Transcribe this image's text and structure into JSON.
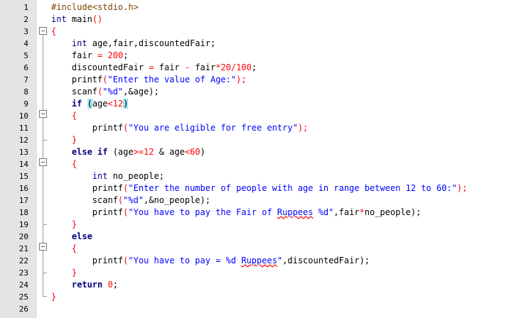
{
  "editor": {
    "lines": [
      {
        "n": "1",
        "segs": [
          {
            "t": "#include<stdio.h>",
            "c": "pp"
          }
        ]
      },
      {
        "n": "2",
        "segs": [
          {
            "t": "int",
            "c": "ty"
          },
          {
            "t": " main",
            "c": "id"
          },
          {
            "t": "()",
            "c": "op"
          }
        ]
      },
      {
        "n": "3",
        "segs": [
          {
            "t": "{",
            "c": "op"
          }
        ]
      },
      {
        "n": "4",
        "segs": [
          {
            "t": "    int",
            "c": "ty"
          },
          {
            "t": " age,fair,discountedFair;",
            "c": "id"
          }
        ]
      },
      {
        "n": "5",
        "segs": [
          {
            "t": "    fair ",
            "c": "id"
          },
          {
            "t": "=",
            "c": "op"
          },
          {
            "t": " ",
            "c": "id"
          },
          {
            "t": "200",
            "c": "nm"
          },
          {
            "t": ";",
            "c": "id"
          }
        ]
      },
      {
        "n": "6",
        "segs": [
          {
            "t": "    discountedFair ",
            "c": "id"
          },
          {
            "t": "=",
            "c": "op"
          },
          {
            "t": " fair ",
            "c": "id"
          },
          {
            "t": "-",
            "c": "op"
          },
          {
            "t": " fair",
            "c": "id"
          },
          {
            "t": "*20/100",
            "c": "nm"
          },
          {
            "t": ";",
            "c": "id"
          }
        ]
      },
      {
        "n": "7",
        "segs": [
          {
            "t": "    printf",
            "c": "id"
          },
          {
            "t": "(",
            "c": "op"
          },
          {
            "t": "\"Enter the value of Age:\"",
            "c": "st"
          },
          {
            "t": ");",
            "c": "op"
          }
        ]
      },
      {
        "n": "8",
        "segs": [
          {
            "t": "    scanf",
            "c": "id"
          },
          {
            "t": "(",
            "c": "op"
          },
          {
            "t": "\"%d\"",
            "c": "st"
          },
          {
            "t": ",&age);",
            "c": "id"
          }
        ]
      },
      {
        "n": "9",
        "segs": [
          {
            "t": "    if ",
            "c": "kw"
          },
          {
            "t": "(",
            "c": "hl"
          },
          {
            "t": "age",
            "c": "id"
          },
          {
            "t": "<12",
            "c": "nm"
          },
          {
            "t": ")",
            "c": "hl"
          }
        ]
      },
      {
        "n": "10",
        "segs": [
          {
            "t": "    {",
            "c": "op"
          }
        ]
      },
      {
        "n": "11",
        "segs": [
          {
            "t": "        printf",
            "c": "id"
          },
          {
            "t": "(",
            "c": "op"
          },
          {
            "t": "\"You are eligible for free entry\"",
            "c": "st"
          },
          {
            "t": ");",
            "c": "op"
          }
        ]
      },
      {
        "n": "12",
        "segs": [
          {
            "t": "    }",
            "c": "op"
          }
        ]
      },
      {
        "n": "13",
        "segs": [
          {
            "t": "    else if ",
            "c": "kw"
          },
          {
            "t": "(age",
            "c": "id"
          },
          {
            "t": ">=12",
            "c": "nm"
          },
          {
            "t": " & age",
            "c": "id"
          },
          {
            "t": "<60",
            "c": "nm"
          },
          {
            "t": ")",
            "c": "id"
          }
        ]
      },
      {
        "n": "14",
        "segs": [
          {
            "t": "    {",
            "c": "op"
          }
        ]
      },
      {
        "n": "15",
        "segs": [
          {
            "t": "        int",
            "c": "ty"
          },
          {
            "t": " no_people;",
            "c": "id"
          }
        ]
      },
      {
        "n": "16",
        "segs": [
          {
            "t": "        printf",
            "c": "id"
          },
          {
            "t": "(",
            "c": "op"
          },
          {
            "t": "\"Enter the number of people with age in range between 12 to 60:\"",
            "c": "st"
          },
          {
            "t": ");",
            "c": "op"
          }
        ]
      },
      {
        "n": "17",
        "segs": [
          {
            "t": "        scanf",
            "c": "id"
          },
          {
            "t": "(",
            "c": "op"
          },
          {
            "t": "\"%d\"",
            "c": "st"
          },
          {
            "t": ",&no_people);",
            "c": "id"
          }
        ]
      },
      {
        "n": "18",
        "segs": [
          {
            "t": "        printf",
            "c": "id"
          },
          {
            "t": "(",
            "c": "op"
          },
          {
            "t": "\"You have to pay the Fair of ",
            "c": "st"
          },
          {
            "t": "Ruppees",
            "c": "st sq"
          },
          {
            "t": " %d\"",
            "c": "st"
          },
          {
            "t": ",fair",
            "c": "id"
          },
          {
            "t": "*",
            "c": "op"
          },
          {
            "t": "no_people);",
            "c": "id"
          }
        ]
      },
      {
        "n": "19",
        "segs": [
          {
            "t": "    }",
            "c": "op"
          }
        ]
      },
      {
        "n": "20",
        "segs": [
          {
            "t": "    else",
            "c": "kw"
          }
        ]
      },
      {
        "n": "21",
        "segs": [
          {
            "t": "    {",
            "c": "op"
          }
        ]
      },
      {
        "n": "22",
        "segs": [
          {
            "t": "        printf",
            "c": "id"
          },
          {
            "t": "(",
            "c": "op"
          },
          {
            "t": "\"You have to pay = %d ",
            "c": "st"
          },
          {
            "t": "Ruppees",
            "c": "st sq"
          },
          {
            "t": "\"",
            "c": "st"
          },
          {
            "t": ",discountedFair);",
            "c": "id"
          }
        ]
      },
      {
        "n": "23",
        "segs": [
          {
            "t": "    }",
            "c": "op"
          }
        ]
      },
      {
        "n": "24",
        "segs": [
          {
            "t": "    return ",
            "c": "kw"
          },
          {
            "t": "0",
            "c": "nm"
          },
          {
            "t": ";",
            "c": "id"
          }
        ]
      },
      {
        "n": "25",
        "segs": [
          {
            "t": "}",
            "c": "op"
          }
        ]
      },
      {
        "n": "26",
        "segs": []
      }
    ],
    "fold_icons": [
      "fold-minus-icon",
      "fold-end-icon"
    ]
  }
}
